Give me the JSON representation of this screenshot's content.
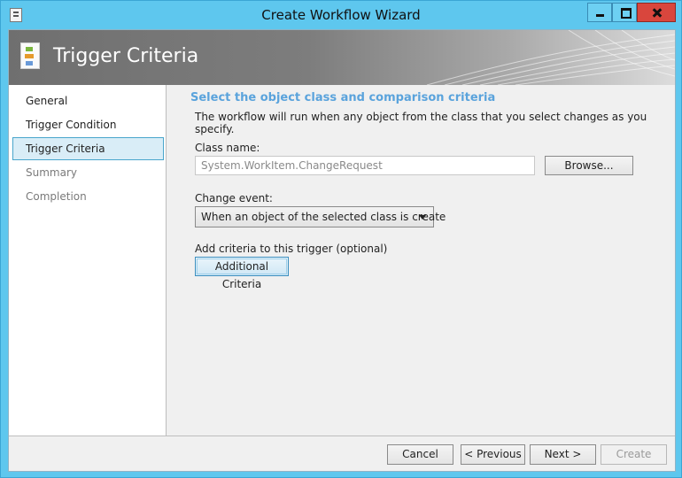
{
  "window": {
    "title": "Create Workflow Wizard"
  },
  "banner": {
    "title": "Trigger Criteria"
  },
  "nav": {
    "items": [
      {
        "label": "General"
      },
      {
        "label": "Trigger Condition"
      },
      {
        "label": "Trigger Criteria",
        "selected": true
      },
      {
        "label": "Summary",
        "disabled": true
      },
      {
        "label": "Completion",
        "disabled": true
      }
    ]
  },
  "main": {
    "heading": "Select the object class and comparison criteria",
    "description": "The workflow will run when any object from the class that you select changes as you specify.",
    "class_name_label": "Class name:",
    "class_name_value": "System.WorkItem.ChangeRequest",
    "browse_label": "Browse...",
    "change_event_label": "Change event:",
    "change_event_value": "When an object of the selected class is create",
    "criteria_label": "Add criteria to this trigger (optional)",
    "criteria_button": "Additional Criteria"
  },
  "footer": {
    "cancel": "Cancel",
    "previous": "< Previous",
    "next": "Next >",
    "create": "Create"
  },
  "colors": {
    "window_frame": "#5ec7ee",
    "heading_accent": "#5aa3dc",
    "selection_fill": "#d9edf7",
    "selection_border": "#49a6cc",
    "close_button": "#d9463d"
  }
}
